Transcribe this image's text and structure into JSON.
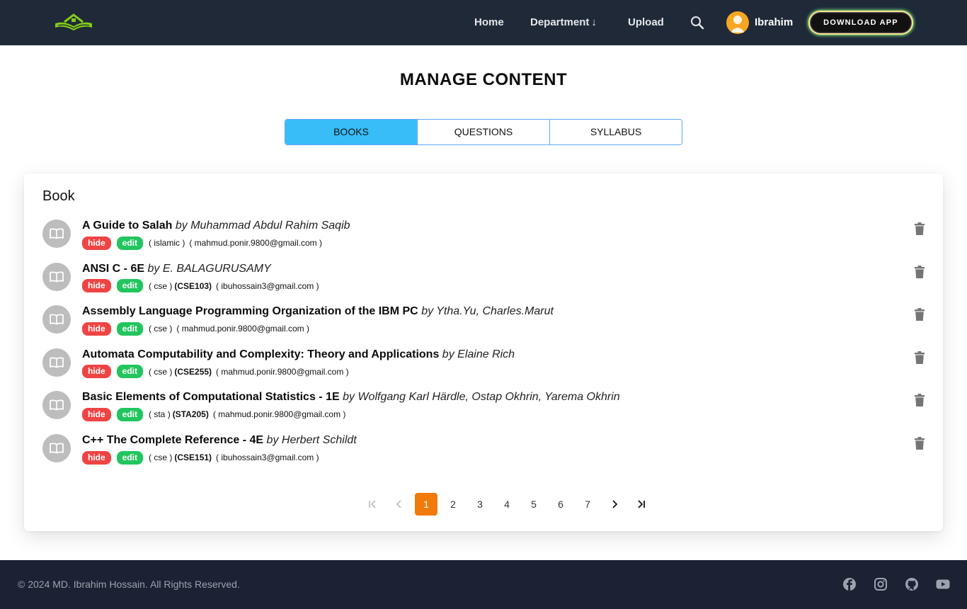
{
  "navbar": {
    "logo_icon": "book-house-logo",
    "links": [
      {
        "label": "Home"
      },
      {
        "label": "Department",
        "arrow": "↓"
      },
      {
        "label": "Upload"
      }
    ],
    "search_icon": "search-icon",
    "user": {
      "name": "Ibrahim",
      "avatar_icon": "user-avatar-icon"
    },
    "download_label": "DOWNLOAD APP"
  },
  "page": {
    "title": "MANAGE CONTENT",
    "tabs": [
      {
        "label": "BOOKS",
        "active": true
      },
      {
        "label": "QUESTIONS",
        "active": false
      },
      {
        "label": "SYLLABUS",
        "active": false
      }
    ]
  },
  "card": {
    "title": "Book",
    "hide_label": "hide",
    "edit_label": "edit",
    "books": [
      {
        "title": "A Guide to Salah",
        "by": "by Muhammad Abdul Rahim Saqib",
        "dept": "( islamic )",
        "code": "",
        "email": "( mahmud.ponir.9800@gmail.com )"
      },
      {
        "title": "ANSI C - 6E",
        "by": "by E. BALAGURUSAMY",
        "dept": "( cse )",
        "code": "(CSE103)",
        "email": "( ibuhossain3@gmail.com )"
      },
      {
        "title": "Assembly Language Programming Organization of the IBM PC",
        "by": "by Ytha.Yu, Charles.Marut",
        "dept": "( cse )",
        "code": "",
        "email": "( mahmud.ponir.9800@gmail.com )"
      },
      {
        "title": "Automata Computability and Complexity: Theory and Applications",
        "by": "by Elaine Rich",
        "dept": "( cse )",
        "code": "(CSE255)",
        "email": "( mahmud.ponir.9800@gmail.com )"
      },
      {
        "title": "Basic Elements of Computational Statistics - 1E",
        "by": "by Wolfgang Karl Härdle, Ostap Okhrin, Yarema Okhrin",
        "dept": "( sta )",
        "code": "(STA205)",
        "email": "( mahmud.ponir.9800@gmail.com )"
      },
      {
        "title": "C++ The Complete Reference - 4E",
        "by": "by Herbert Schildt",
        "dept": "( cse )",
        "code": "(CSE151)",
        "email": "( ibuhossain3@gmail.com )"
      }
    ]
  },
  "pagination": {
    "pages": [
      "1",
      "2",
      "3",
      "4",
      "5",
      "6",
      "7"
    ],
    "current": "1",
    "accent": "#f07a0c"
  },
  "footer": {
    "copyright": "© 2024 MD. Ibrahim Hossain. All Rights Reserved.",
    "social_icons": [
      "facebook-icon",
      "instagram-icon",
      "github-icon",
      "youtube-icon"
    ]
  },
  "colors": {
    "navbar_bg": "#1f2937",
    "tab_active": "#38bdf8",
    "hide_badge": "#ef4444",
    "edit_badge": "#22c55e",
    "footer_bg": "#1a2233"
  }
}
